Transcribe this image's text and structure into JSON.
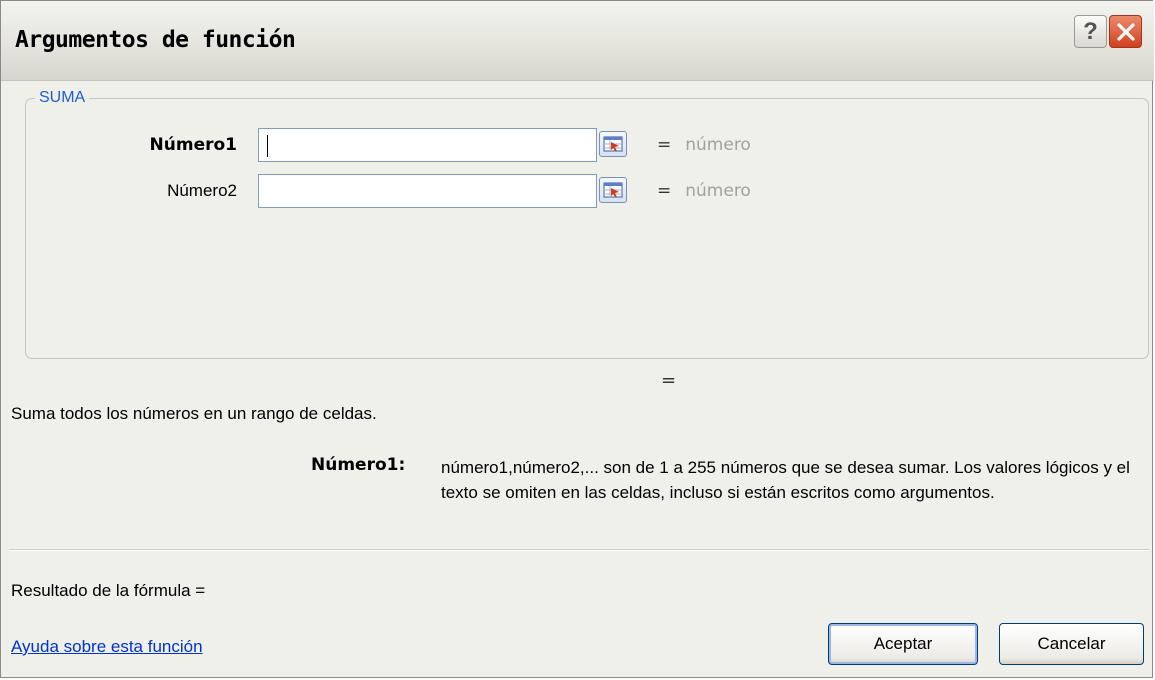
{
  "window": {
    "title": "Argumentos de función",
    "help_glyph": "?",
    "colors": {
      "title_bg": "#e4e4dc",
      "close_bg": "#d1401e",
      "group_label": "#1f5cd8",
      "link": "#0033cc"
    }
  },
  "group": {
    "label": "SUMA",
    "arguments": [
      {
        "label": "Número1",
        "value": "",
        "result_eq": "=",
        "result": "número",
        "active": true
      },
      {
        "label": "Número2",
        "value": "",
        "result_eq": "=",
        "result": "número",
        "active": false
      }
    ]
  },
  "function_result_eq": "=",
  "description": "Suma todos los números en un rango de celdas.",
  "argument_help": {
    "name": "Número1:",
    "text": "número1,número2,... son de 1 a 255 números que se desea sumar. Los valores lógicos y el texto se omiten en las celdas, incluso si están escritos como argumentos."
  },
  "formula_result": "Resultado de la fórmula =",
  "help_link": "Ayuda sobre esta función",
  "buttons": {
    "ok": "Aceptar",
    "cancel": "Cancelar"
  },
  "icons": {
    "help": "question-mark-icon",
    "close": "close-x-icon",
    "ref": "collapse-dialog-icon"
  }
}
